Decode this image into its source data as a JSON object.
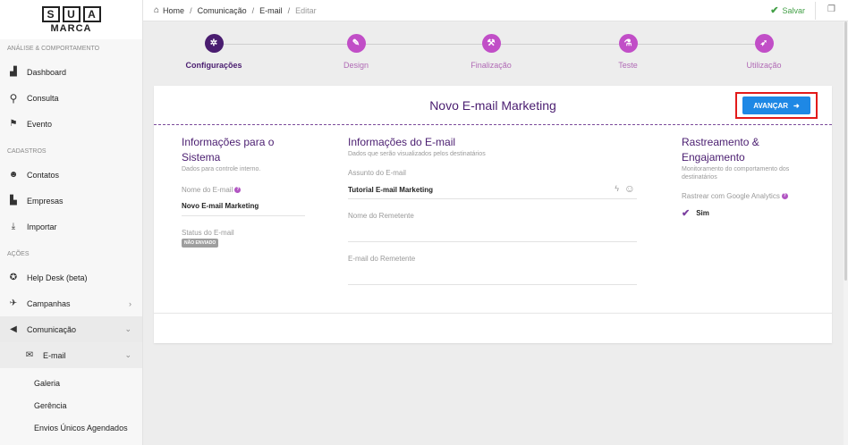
{
  "logo": {
    "letters": [
      "S",
      "U",
      "A"
    ],
    "sub": "MARCA"
  },
  "sidebar": {
    "section1": "ANÁLISE & COMPORTAMENTO",
    "dashboard": "Dashboard",
    "consulta": "Consulta",
    "evento": "Evento",
    "section2": "CADASTROS",
    "contatos": "Contatos",
    "empresas": "Empresas",
    "importar": "Importar",
    "section3": "AÇÕES",
    "helpdesk": "Help Desk (beta)",
    "campanhas": "Campanhas",
    "comunicacao": "Comunicação",
    "email": "E-mail",
    "galeria": "Galeria",
    "gerencia": "Gerência",
    "envios": "Envios Únicos Agendados"
  },
  "breadcrumb": {
    "home": "Home",
    "comunicacao": "Comunicação",
    "email": "E-mail",
    "editar": "Editar"
  },
  "topbar": {
    "save": "Salvar"
  },
  "steps": [
    "Configurações",
    "Design",
    "Finalização",
    "Teste",
    "Utilização"
  ],
  "card": {
    "title": "Novo E-mail Marketing",
    "advance": "AVANÇAR"
  },
  "col1": {
    "title": "Informações para o Sistema",
    "desc": "Dados para controle interno.",
    "name_label": "Nome do E-mail",
    "name_value": "Novo E-mail Marketing",
    "status_label": "Status do E-mail",
    "status_value": "NÃO ENVIADO"
  },
  "col2": {
    "title": "Informações do E-mail",
    "desc": "Dados que serão visualizados pelos destinatários",
    "subject_label": "Assunto do E-mail",
    "subject_value": "Tutorial E-mail Marketing",
    "sender_label": "Nome do Remetente",
    "sender_email_label": "E-mail do Remetente"
  },
  "col3": {
    "title": "Rastreamento & Engajamento",
    "desc": "Monitoramento do comportamento dos destinatários",
    "ga_label": "Rastrear com Google Analytics",
    "ga_value": "Sim"
  },
  "colors": {
    "brand_purple": "#4a1d70",
    "accent_pink": "#c14ec7",
    "primary_blue": "#1e88e5",
    "success_green": "#43a047",
    "highlight_red": "#e21a1a"
  },
  "icons": [
    "home-icon",
    "check-icon",
    "window-icon",
    "gear-icon",
    "pen-icon",
    "hammer-icon",
    "flask-icon",
    "rocket-icon",
    "arrow-right-icon",
    "bolt-icon",
    "smiley-icon",
    "help-icon"
  ]
}
